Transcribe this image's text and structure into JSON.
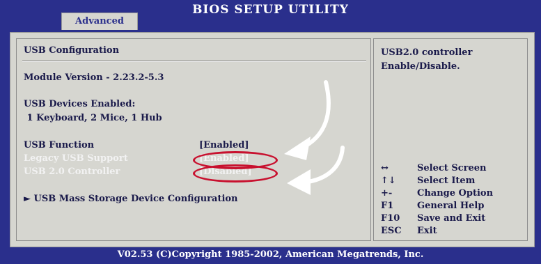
{
  "header": {
    "tab_label": "Advanced",
    "title": "BIOS SETUP UTILITY"
  },
  "main": {
    "section_title": "USB Configuration",
    "module_version": "Module Version - 2.23.2-5.3",
    "devices_label": "USB Devices Enabled:",
    "devices_value": " 1 Keyboard, 2 Mice, 1 Hub",
    "items": [
      {
        "label": "USB Function",
        "value": "[Enabled]"
      },
      {
        "label": "Legacy USB Support",
        "value": "[Enabled]"
      },
      {
        "label": "USB 2.0 Controller",
        "value": "[Disabled]"
      }
    ],
    "submenu": "► USB Mass Storage Device Configuration"
  },
  "help": {
    "text_line1": "USB2.0 controller",
    "text_line2": "Enable/Disable.",
    "keys": [
      {
        "key": "↔",
        "desc": "Select Screen"
      },
      {
        "key": "↑↓",
        "desc": "Select Item"
      },
      {
        "key": "+-",
        "desc": "Change Option"
      },
      {
        "key": "F1",
        "desc": "General Help"
      },
      {
        "key": "F10",
        "desc": "Save and Exit"
      },
      {
        "key": "ESC",
        "desc": "Exit"
      }
    ]
  },
  "footer": {
    "text": "V02.53 (C)Copyright 1985-2002, American Megatrends, Inc."
  },
  "colors": {
    "bios_blue": "#2a2f8c",
    "panel_gray": "#d6d6d0",
    "annotation_red": "#c8102e"
  }
}
